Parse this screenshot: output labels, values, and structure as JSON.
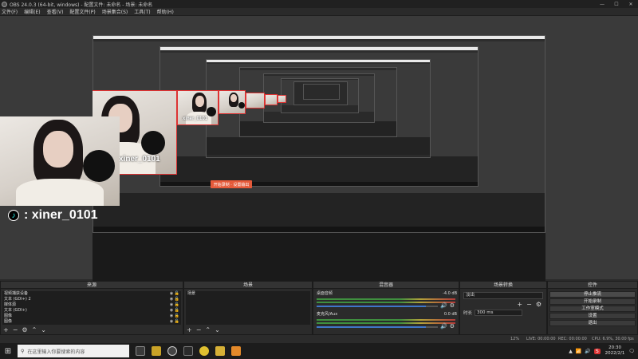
{
  "window": {
    "title": "OBS 24.0.3 (64-bit, windows) - 配置文件: 未命名 - 场景: 未命名"
  },
  "menu": [
    "文件(F)",
    "编辑(E)",
    "查看(V)",
    "配置文件(P)",
    "场景集合(S)",
    "工具(T)",
    "帮助(H)"
  ],
  "preview": {
    "cam_label": "xiner_0101",
    "tiktok_handle": ": xiner_0101",
    "rec_button": "开始录制 · 设置输出"
  },
  "docks": {
    "sources": {
      "title": "来源",
      "items": [
        "视频捕获设备",
        "文本 (GDI+) 2",
        "媒体源",
        "文本 (GDI+)",
        "图像",
        "图像"
      ]
    },
    "scenes": {
      "title": "场景",
      "items": [
        "场景"
      ]
    },
    "mixer": {
      "title": "混音器",
      "tracks": [
        {
          "name": "桌面音频",
          "db": "-4.0 dB"
        },
        {
          "name": "麦克风/Aux",
          "db": "0.0 dB"
        }
      ]
    },
    "transitions": {
      "title": "场景转换",
      "type": "淡出",
      "duration_label": "时长",
      "duration_value": "300 ms"
    },
    "controls": {
      "title": "控件",
      "buttons": [
        "停止推流",
        "开始录制",
        "工作室模式",
        "设置",
        "退出"
      ]
    }
  },
  "status": {
    "fps": "12%",
    "live": "LIVE: 00:00:00",
    "rec": "REC: 00:00:00",
    "cpu": "CPU: 6.9%, 30.00 fps"
  },
  "taskbar": {
    "search_placeholder": "在这里输入你要搜索的内容",
    "time": "20:30",
    "date": "2022/2/1"
  },
  "colors": {
    "accent": "#3f77c9",
    "rec": "#e55a3a",
    "cam_border": "#dd3333"
  }
}
